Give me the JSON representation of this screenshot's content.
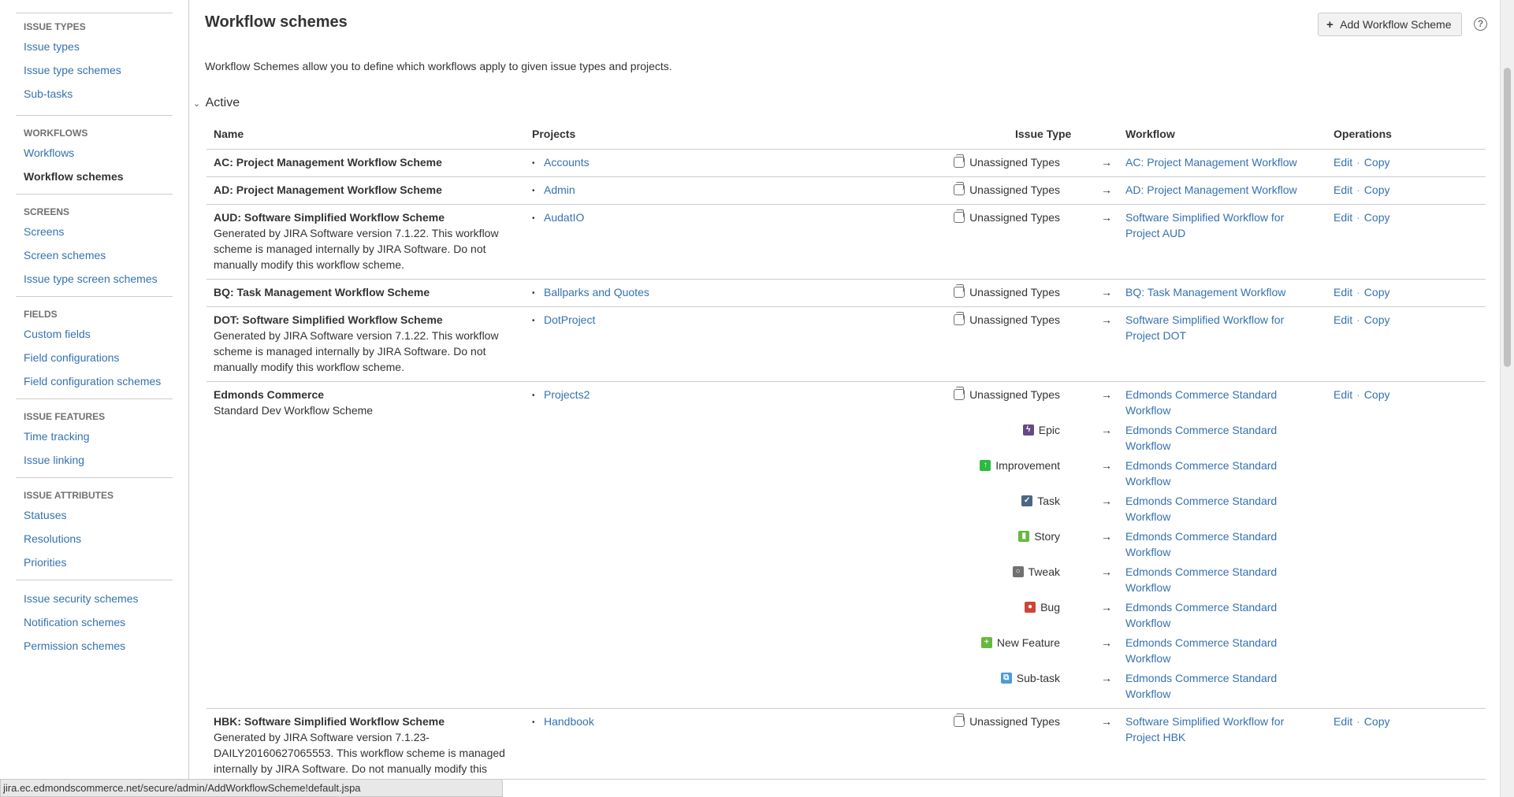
{
  "sidebar": {
    "groups": [
      {
        "heading": "ISSUE TYPES",
        "items": [
          "Issue types",
          "Issue type schemes",
          "Sub-tasks"
        ]
      },
      {
        "heading": "WORKFLOWS",
        "items": [
          "Workflows",
          "Workflow schemes"
        ]
      },
      {
        "heading": "SCREENS",
        "items": [
          "Screens",
          "Screen schemes",
          "Issue type screen schemes"
        ]
      },
      {
        "heading": "FIELDS",
        "items": [
          "Custom fields",
          "Field configurations",
          "Field configuration schemes"
        ]
      },
      {
        "heading": "ISSUE FEATURES",
        "items": [
          "Time tracking",
          "Issue linking"
        ]
      },
      {
        "heading": "ISSUE ATTRIBUTES",
        "items": [
          "Statuses",
          "Resolutions",
          "Priorities"
        ]
      },
      {
        "heading": "",
        "items": [
          "Issue security schemes",
          "Notification schemes",
          "Permission schemes"
        ]
      }
    ],
    "active_item": "Workflow schemes"
  },
  "header": {
    "title": "Workflow schemes",
    "add_button_label": "Add Workflow Scheme",
    "help_icon": "?",
    "description": "Workflow Schemes allow you to define which workflows apply to given issue types and projects."
  },
  "section": {
    "label": "Active",
    "chevron": "⌄"
  },
  "table": {
    "columns": {
      "name": "Name",
      "projects": "Projects",
      "issue_type": "Issue Type",
      "workflow": "Workflow",
      "operations": "Operations"
    },
    "arrow": "→",
    "ops": {
      "edit": "Edit",
      "copy": "Copy",
      "sep": "·"
    },
    "rows": [
      {
        "name": "AC: Project Management Workflow Scheme",
        "desc": "",
        "project": "Accounts",
        "mappings": [
          {
            "type": "Unassigned Types",
            "icon": "unassigned",
            "workflow": "AC: Project Management Workflow"
          }
        ]
      },
      {
        "name": "AD: Project Management Workflow Scheme",
        "desc": "",
        "project": "Admin",
        "mappings": [
          {
            "type": "Unassigned Types",
            "icon": "unassigned",
            "workflow": "AD: Project Management Workflow"
          }
        ]
      },
      {
        "name": "AUD: Software Simplified Workflow Scheme",
        "desc": "Generated by JIRA Software version 7.1.22. This workflow scheme is managed internally by JIRA Software. Do not manually modify this workflow scheme.",
        "project": "AudatIO",
        "mappings": [
          {
            "type": "Unassigned Types",
            "icon": "unassigned",
            "workflow": "Software Simplified Workflow for Project AUD"
          }
        ]
      },
      {
        "name": "BQ: Task Management Workflow Scheme",
        "desc": "",
        "project": "Ballparks and Quotes",
        "mappings": [
          {
            "type": "Unassigned Types",
            "icon": "unassigned",
            "workflow": "BQ: Task Management Workflow"
          }
        ]
      },
      {
        "name": "DOT: Software Simplified Workflow Scheme",
        "desc": "Generated by JIRA Software version 7.1.22. This workflow scheme is managed internally by JIRA Software. Do not manually modify this workflow scheme.",
        "project": "DotProject",
        "mappings": [
          {
            "type": "Unassigned Types",
            "icon": "unassigned",
            "workflow": "Software Simplified Workflow for Project DOT"
          }
        ]
      },
      {
        "name": "Edmonds Commerce",
        "desc": "Standard Dev Workflow Scheme",
        "project": "Projects2",
        "mappings": [
          {
            "type": "Unassigned Types",
            "icon": "unassigned",
            "workflow": "Edmonds Commerce Standard Workflow"
          },
          {
            "type": "Epic",
            "icon": "epic",
            "workflow": "Edmonds Commerce Standard Workflow"
          },
          {
            "type": "Improvement",
            "icon": "improvement",
            "workflow": "Edmonds Commerce Standard Workflow"
          },
          {
            "type": "Task",
            "icon": "task",
            "workflow": "Edmonds Commerce Standard Workflow"
          },
          {
            "type": "Story",
            "icon": "story",
            "workflow": "Edmonds Commerce Standard Workflow"
          },
          {
            "type": "Tweak",
            "icon": "tweak",
            "workflow": "Edmonds Commerce Standard Workflow"
          },
          {
            "type": "Bug",
            "icon": "bug",
            "workflow": "Edmonds Commerce Standard Workflow"
          },
          {
            "type": "New Feature",
            "icon": "newfeature",
            "workflow": "Edmonds Commerce Standard Workflow"
          },
          {
            "type": "Sub-task",
            "icon": "subtask",
            "workflow": "Edmonds Commerce Standard Workflow"
          }
        ]
      },
      {
        "name": "HBK: Software Simplified Workflow Scheme",
        "desc": "Generated by JIRA Software version 7.1.23-DAILY20160627065553. This workflow scheme is managed internally by JIRA Software. Do not manually modify this",
        "project": "Handbook",
        "mappings": [
          {
            "type": "Unassigned Types",
            "icon": "unassigned",
            "workflow": "Software Simplified Workflow for Project HBK"
          }
        ]
      }
    ]
  },
  "statusbar": {
    "url": "jira.ec.edmondscommerce.net/secure/admin/AddWorkflowScheme!default.jspa"
  }
}
